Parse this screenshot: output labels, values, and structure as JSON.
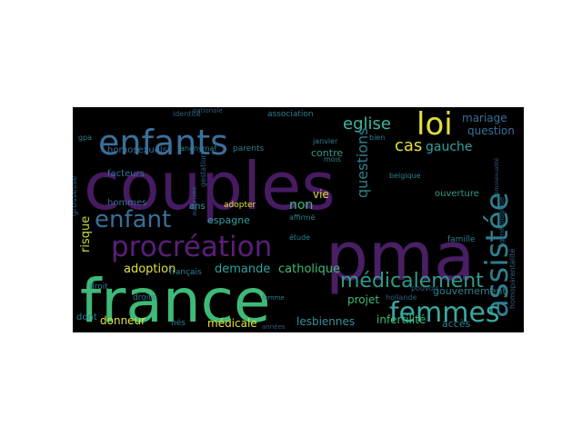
{
  "background_color": "#000000",
  "palette": {
    "purple": "#44105c",
    "deep_purple": "#3a1a5e",
    "blue": "#3b6f9c",
    "teal": "#2f8d87",
    "green": "#3cb878",
    "yellow": "#d6d83a",
    "dim": "#2b5f73"
  },
  "words": [
    {
      "text": "couples",
      "color": "#471b61"
    },
    {
      "text": "pma",
      "color": "#4a1f64"
    },
    {
      "text": "france",
      "color": "#3fb978"
    },
    {
      "text": "enfants",
      "color": "#3a6f9b"
    },
    {
      "text": "procréation",
      "color": "#5a1f78"
    },
    {
      "text": "assistée",
      "color": "#2f7f8f"
    },
    {
      "text": "loi",
      "color": "#dfe03a"
    },
    {
      "text": "femmes",
      "color": "#3aa7a0"
    },
    {
      "text": "enfant",
      "color": "#3a6f9b"
    },
    {
      "text": "médicalement",
      "color": "#2f9b8d"
    },
    {
      "text": "eglise",
      "color": "#3fb5a0"
    },
    {
      "text": "cas",
      "color": "#dfe03a"
    },
    {
      "text": "gauche",
      "color": "#2fa2a0"
    },
    {
      "text": "questions",
      "color": "#2f7f8f"
    },
    {
      "text": "mariage",
      "color": "#3a6f9b"
    },
    {
      "text": "question",
      "color": "#3a6f9b"
    },
    {
      "text": "risque",
      "color": "#c6d83a"
    },
    {
      "text": "adoption",
      "color": "#dfe03a"
    },
    {
      "text": "demande",
      "color": "#2fa2a0"
    },
    {
      "text": "catholique",
      "color": "#3fb978"
    },
    {
      "text": "espagne",
      "color": "#2fa2a0"
    },
    {
      "text": "projet",
      "color": "#3fb978"
    },
    {
      "text": "infertilité",
      "color": "#3fb978"
    },
    {
      "text": "lesbiennes",
      "color": "#3a8f9b"
    },
    {
      "text": "donneur",
      "color": "#dfe03a"
    },
    {
      "text": "médicale",
      "color": "#dfe03a"
    },
    {
      "text": "accès",
      "color": "#2f7f8f"
    },
    {
      "text": "gouvernement",
      "color": "#2f7f8f"
    },
    {
      "text": "non",
      "color": "#3fb978"
    },
    {
      "text": "vie",
      "color": "#d6d83a"
    },
    {
      "text": "contre",
      "color": "#2f9b8d"
    },
    {
      "text": "ouverture",
      "color": "#2f9b8d"
    },
    {
      "text": "hommes",
      "color": "#3a6f9b"
    },
    {
      "text": "facteurs",
      "color": "#3a6f9b"
    },
    {
      "text": "homosexuels",
      "color": "#3a6f9b"
    },
    {
      "text": "association",
      "color": "#2f7f8f"
    },
    {
      "text": "parents",
      "color": "#2f7f8f"
    },
    {
      "text": "adopter",
      "color": "#dfe03a"
    },
    {
      "text": "ans",
      "color": "#2fa2a0"
    },
    {
      "text": "droit",
      "color": "#2f7f8f"
    },
    {
      "text": "droits",
      "color": "#2f7f8f"
    },
    {
      "text": "français",
      "color": "#2f7f8f"
    },
    {
      "text": "famille",
      "color": "#2f7f8f"
    },
    {
      "text": "homoparentalité",
      "color": "#2f5f7f"
    },
    {
      "text": "étude",
      "color": "#2f7f8f"
    },
    {
      "text": "affirmé",
      "color": "#2f7f8f"
    },
    {
      "text": "gestation",
      "color": "#2f5f7f"
    },
    {
      "text": "anonymat",
      "color": "#2f7f8f"
    },
    {
      "text": "janvier",
      "color": "#2f7f8f"
    },
    {
      "text": "belgique",
      "color": "#2f7f8f"
    },
    {
      "text": "mois",
      "color": "#2f7f8f"
    },
    {
      "text": "bien",
      "color": "#2f7f8f"
    },
    {
      "text": "pouvoir",
      "color": "#2f5f7f"
    },
    {
      "text": "hollande",
      "color": "#2f5f7f"
    },
    {
      "text": "dont",
      "color": "#2f7f8f"
    },
    {
      "text": "nés",
      "color": "#2f7f8f"
    },
    {
      "text": "années",
      "color": "#2f5f7f"
    },
    {
      "text": "gpa",
      "color": "#2f7f8f"
    },
    {
      "text": "identité",
      "color": "#2f5f7f"
    },
    {
      "text": "nationale",
      "color": "#2f5f7f"
    },
    {
      "text": "grossesse",
      "color": "#2f5f7f"
    },
    {
      "text": "autorisée",
      "color": "#2f5f7f"
    },
    {
      "text": "gynécologique",
      "color": "#2f5f7f"
    },
    {
      "text": "homosexualité",
      "color": "#2f5f7f"
    },
    {
      "text": "femme",
      "color": "#2f7f8f"
    }
  ]
}
